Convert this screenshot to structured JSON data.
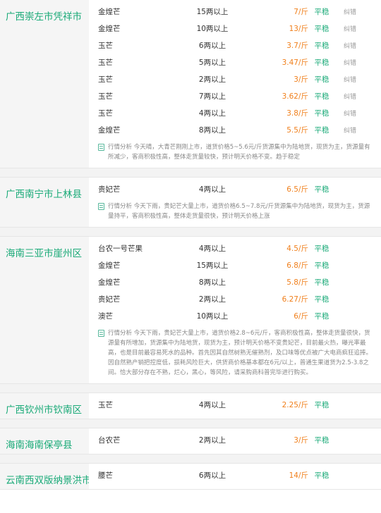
{
  "regions": [
    {
      "name": "广西崇左市凭祥市",
      "rows": [
        {
          "variety": "金煌芒",
          "spec": "15两以上",
          "price": "7/斤",
          "trend": "平稳",
          "report": "纠错"
        },
        {
          "variety": "金煌芒",
          "spec": "10两以上",
          "price": "13/斤",
          "trend": "平稳",
          "report": "纠错"
        },
        {
          "variety": "玉芒",
          "spec": "6两以上",
          "price": "3.7/斤",
          "trend": "平稳",
          "report": "纠错"
        },
        {
          "variety": "玉芒",
          "spec": "5两以上",
          "price": "3.47/斤",
          "trend": "平稳",
          "report": "纠错"
        },
        {
          "variety": "玉芒",
          "spec": "2两以上",
          "price": "3/斤",
          "trend": "平稳",
          "report": "纠错"
        },
        {
          "variety": "玉芒",
          "spec": "7两以上",
          "price": "3.62/斤",
          "trend": "平稳",
          "report": "纠错"
        },
        {
          "variety": "玉芒",
          "spec": "4两以上",
          "price": "3.8/斤",
          "trend": "平稳",
          "report": "纠错"
        },
        {
          "variety": "金煌芒",
          "spec": "8两以上",
          "price": "5.5/斤",
          "trend": "平稳",
          "report": "纠错"
        }
      ],
      "analysis": "行情分析 今天晴，大青芒刚刚上市，道货价格5~5.6元/斤货源集中为陆地货，现货为主，货源量有所减少，客商积极性高，整体走货量较快，预计明天价格不变。趋于稳定"
    },
    {
      "name": "广西南宁市上林县",
      "rows": [
        {
          "variety": "贵妃芒",
          "spec": "4两以上",
          "price": "6.5/斤",
          "trend": "平稳",
          "report": ""
        }
      ],
      "analysis": "行情分析 今天下雨，贵妃芒大量上市，道货价格6.5~7.8元/斤货源集中为陆地货，现货为主，货源量持平，客商积极性高，整体走货量很快，预计明天价格上涨"
    },
    {
      "name": "海南三亚市崖州区",
      "rows": [
        {
          "variety": "台农一号芒果",
          "spec": "4两以上",
          "price": "4.5/斤",
          "trend": "平稳",
          "report": ""
        },
        {
          "variety": "金煌芒",
          "spec": "15两以上",
          "price": "6.8/斤",
          "trend": "平稳",
          "report": ""
        },
        {
          "variety": "金煌芒",
          "spec": "8两以上",
          "price": "5.8/斤",
          "trend": "平稳",
          "report": ""
        },
        {
          "variety": "贵妃芒",
          "spec": "2两以上",
          "price": "6.27/斤",
          "trend": "平稳",
          "report": ""
        },
        {
          "variety": "澳芒",
          "spec": "10两以上",
          "price": "6/斤",
          "trend": "平稳",
          "report": ""
        }
      ],
      "analysis": "行情分析 今天下雨，贵妃芒大量上市，道货价格2.8~6元/斤，客商积极性高，整体走货量很快，货源量有所增加，货源集中为陆地货，现货为主，预计明天价格不变贵妃芒，目前最火热，曝光率最高，也是目前最容易死水的品种。首先因其自然树熟无催熟剂，及口味等优点被广大电商疯狂追捧。因自然熟产销把控度低，损耗风险巨大，供货商价格基本都在6元/以上，普通生果道货为2.5-3.8之间。恰大部分存在不熟，烂心，黑心，等风险，请采购商科普完毕进行购买。"
    },
    {
      "name": "广西钦州市钦南区",
      "rows": [
        {
          "variety": "玉芒",
          "spec": "4两以上",
          "price": "2.25/斤",
          "trend": "平稳",
          "report": ""
        }
      ],
      "analysis": ""
    },
    {
      "name": "海南海南保亭县",
      "rows": [
        {
          "variety": "台农芒",
          "spec": "2两以上",
          "price": "3/斤",
          "trend": "平稳",
          "report": ""
        }
      ],
      "analysis": ""
    },
    {
      "name": "云南西双版纳景洪市",
      "rows": [
        {
          "variety": "腰芒",
          "spec": "6两以上",
          "price": "14/斤",
          "trend": "平稳",
          "report": ""
        }
      ],
      "analysis": ""
    }
  ]
}
